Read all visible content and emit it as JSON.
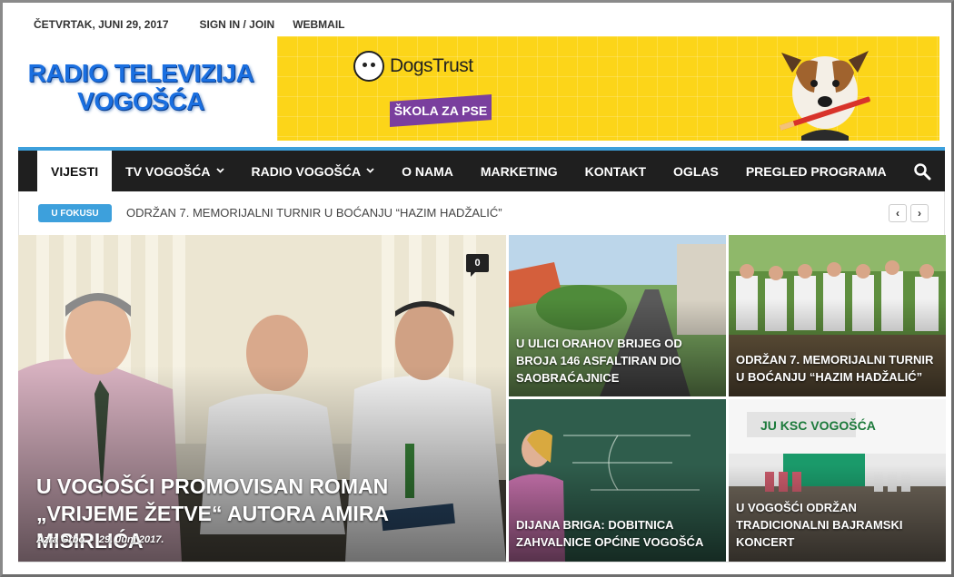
{
  "topbar": {
    "date": "ČETVRTAK, JUNI 29, 2017",
    "signin": "SIGN IN / JOIN",
    "webmail": "WEBMAIL"
  },
  "logo": {
    "line1": "RADIO TELEVIZIJA",
    "line2": "VOGOŠĆA"
  },
  "banner": {
    "brand": "DogsTrust",
    "tagline": "ŠKOLA ZA PSE"
  },
  "nav": {
    "items": [
      {
        "label": "VIJESTI",
        "active": true,
        "dropdown": false
      },
      {
        "label": "TV VOGOŠĆA",
        "dropdown": true
      },
      {
        "label": "RADIO VOGOŠĆA",
        "dropdown": true
      },
      {
        "label": "O NAMA",
        "dropdown": false
      },
      {
        "label": "MARKETING",
        "dropdown": false
      },
      {
        "label": "KONTAKT",
        "dropdown": false
      },
      {
        "label": "OGLAS",
        "dropdown": false
      },
      {
        "label": "PREGLED PROGRAMA",
        "dropdown": false
      }
    ],
    "search_icon": "search-icon",
    "chevron": "⌄"
  },
  "ticker": {
    "badge": "U FOKUSU",
    "headline": "ODRŽAN 7. MEMORIJALNI TURNIR U BOĆANJU “HAZIM HADŽALIĆ”",
    "prev": "‹",
    "next": "›"
  },
  "featured": {
    "title": "U VOGOŠĆI PROMOVISAN ROMAN „VRIJEME ŽETVE“ AUTORA AMIRA MISIRLIĆA",
    "author": "Azra Grbo",
    "separator": "-",
    "date": "29. Juni 2017.",
    "comments": "0"
  },
  "cards": [
    {
      "title": "U ULICI ORAHOV BRIJEG OD BROJA 146 ASFALTIRAN DIO SAOBRAĆAJNICE"
    },
    {
      "title": "ODRŽAN 7. MEMORIJALNI TURNIR U BOĆANJU “HAZIM HADŽALIĆ”"
    },
    {
      "title": "DIJANA BRIGA: DOBITNICA ZAHVALNICE OPĆINE VOGOŠĆA"
    },
    {
      "title": "U VOGOŠĆI ODRŽAN TRADICIONALNI BAJRAMSKI KONCERT"
    }
  ],
  "colors": {
    "accent": "#3da0dc",
    "nav_bg": "#1f1f1f",
    "logo_blue": "#1a6fe0",
    "banner_yellow": "#fcd519",
    "banner_purple": "#7a3f9e"
  }
}
